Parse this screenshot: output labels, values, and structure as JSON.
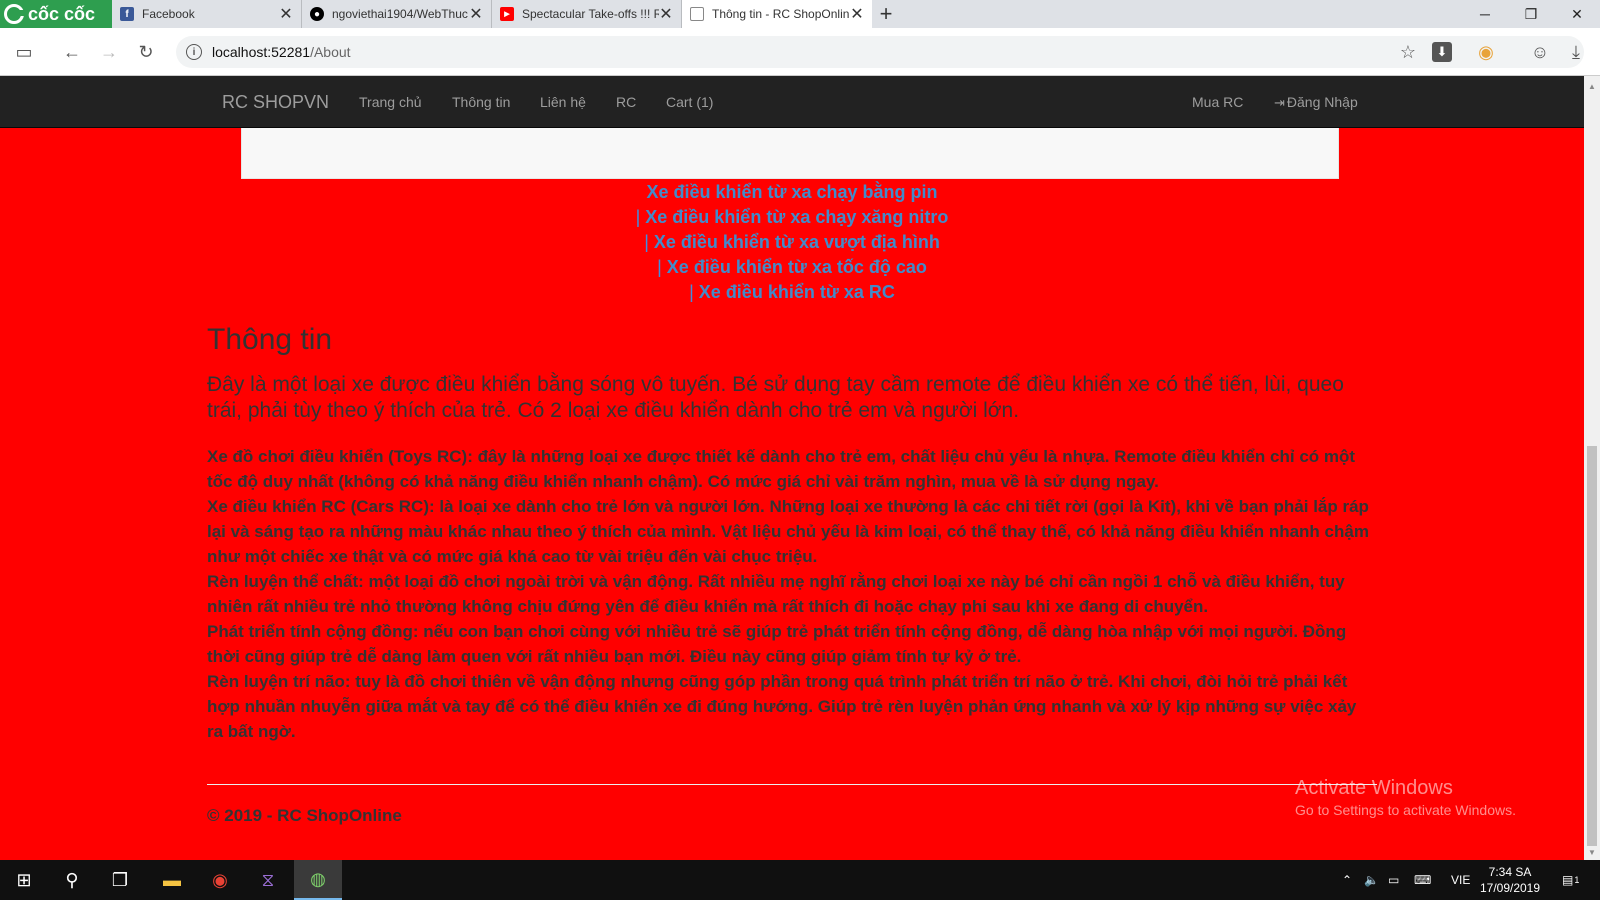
{
  "browser": {
    "brand": "cốc cốc",
    "tabs": [
      {
        "title": "Facebook",
        "favicon": "facebook-icon",
        "color": "#3b5998"
      },
      {
        "title": "ngoviethai1904/WebThuc",
        "favicon": "github-icon",
        "color": "#000000"
      },
      {
        "title": "Spectacular Take-offs !!! R",
        "favicon": "youtube-icon",
        "color": "#ff0000"
      },
      {
        "title": "Thông tin - RC ShopOnlin",
        "favicon": "page-icon",
        "color": "#888888"
      }
    ],
    "address": {
      "host": "localhost:52281",
      "path": "/About"
    }
  },
  "navbar": {
    "brand": "RC SHOPVN",
    "links": [
      "Trang chủ",
      "Thông tin",
      "Liên hệ",
      "RC",
      "Cart (1)"
    ],
    "right": {
      "buy": "Mua RC",
      "login": "Đăng Nhập"
    }
  },
  "categories": [
    {
      "prefix": "",
      "label": "Xe điều khiển từ xa chạy bằng pin"
    },
    {
      "prefix": "|",
      "label": "Xe điều khiển từ xa chạy xăng nitro"
    },
    {
      "prefix": "|",
      "label": "Xe điều khiển từ xa vượt địa hình"
    },
    {
      "prefix": "|",
      "label": "Xe điều khiển từ xa tốc độ cao"
    },
    {
      "prefix": "|",
      "label": "Xe điều khiển từ xa RC"
    }
  ],
  "content": {
    "heading": "Thông tin",
    "lead": "Đây là một loại xe được điều khiển bằng sóng vô tuyến. Bé sử dụng tay cầm remote để điều khiển xe có thể tiến, lùi, queo trái, phải tùy theo ý thích của trẻ. Có 2 loại xe điều khiển dành cho trẻ em và người lớn.",
    "paragraphs": [
      "Xe đồ chơi điều khiển (Toys RC): đây là những loại xe được thiết kế dành cho trẻ em, chất liệu chủ yếu là nhựa. Remote điều khiển chỉ có một tốc độ duy nhất (không có khả năng điều khiển nhanh chậm). Có mức giá chỉ vài trăm nghìn, mua về là sử dụng ngay.",
      "Xe điều khiển RC (Cars RC): là loại xe dành cho trẻ lớn và người lớn. Những loại xe thường là các chi tiết rời (gọi là Kit), khi về bạn phải lắp ráp lại và sáng tạo ra những màu khác nhau theo ý thích của mình. Vật liệu chủ yếu là kim loại, có thể thay thế, có khả năng điều khiển nhanh chậm như một chiếc xe thật và có mức giá khá cao từ vài triệu đến vài chục triệu.",
      "Rèn luyện thể chất: một loại đồ chơi ngoài trời và vận động. Rất nhiều mẹ nghĩ rằng chơi loại xe này bé chỉ cần ngồi 1 chỗ và điều khiển, tuy nhiên rất nhiều trẻ nhỏ thường không chịu đứng yên để điều khiển mà rất thích đi hoặc chạy phi sau khi xe đang di chuyển.",
      "Phát triển tính cộng đồng: nếu con bạn chơi cùng với nhiều trẻ sẽ giúp trẻ phát triển tính cộng đồng, dễ dàng hòa nhập với mọi người. Đồng thời cũng giúp trẻ dễ dàng làm quen với rất nhiều bạn mới. Điều này cũng giúp giảm tính tự kỷ ở trẻ.",
      "Rèn luyện trí não: tuy là đồ chơi thiên về vận động nhưng cũng góp phần trong quá trình phát triển trí não ở trẻ. Khi chơi, đòi hỏi trẻ phải kết hợp nhuần nhuyễn giữa mắt và tay để có thể điều khiển xe đi đúng hướng. Giúp trẻ rèn luyện phản ứng nhanh và xử lý kịp những sự việc xảy ra bất ngờ."
    ],
    "footer": "© 2019 - RC ShopOnline"
  },
  "watermark": {
    "title": "Activate Windows",
    "subtitle": "Go to Settings to activate Windows."
  },
  "taskbar": {
    "lang": "VIE",
    "time": "7:34 SA",
    "date": "17/09/2019",
    "notifications": "1"
  },
  "colors": {
    "page_bg": "#ff0000",
    "navbar_bg": "#222222",
    "link": "#428bca"
  }
}
